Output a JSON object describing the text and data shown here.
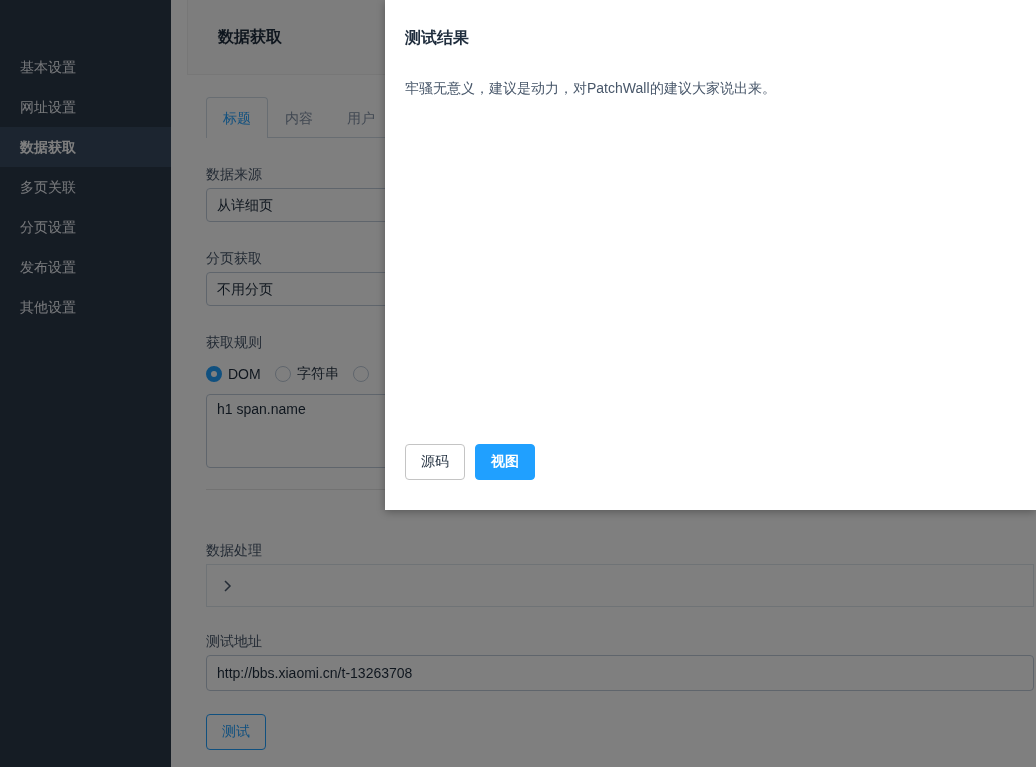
{
  "sidebar": {
    "items": [
      {
        "label": "基本设置",
        "selected": false
      },
      {
        "label": "网址设置",
        "selected": false
      },
      {
        "label": "数据获取",
        "selected": true
      },
      {
        "label": "多页关联",
        "selected": false
      },
      {
        "label": "分页设置",
        "selected": false
      },
      {
        "label": "发布设置",
        "selected": false
      },
      {
        "label": "其他设置",
        "selected": false
      }
    ]
  },
  "header": {
    "title": "数据获取"
  },
  "tabs": [
    {
      "label": "标题",
      "selected": true
    },
    {
      "label": "内容",
      "selected": false
    },
    {
      "label": "用户",
      "selected": false
    }
  ],
  "form": {
    "source": {
      "label": "数据来源",
      "value": "从详细页"
    },
    "paging": {
      "label": "分页获取",
      "value": "不用分页"
    },
    "rule": {
      "label": "获取规则",
      "options": [
        {
          "label": "DOM",
          "selected": true
        },
        {
          "label": "字符串",
          "selected": false
        },
        {
          "selected": false
        }
      ],
      "value": "h1 span.name"
    },
    "processing": {
      "label": "数据处理",
      "expanded": false
    },
    "test_url": {
      "label": "测试地址",
      "value": "http://bbs.xiaomi.cn/t-13263708"
    },
    "test_button": "测试"
  },
  "modal": {
    "title": "测试结果",
    "body": "牢骚无意义，建议是动力，对PatchWall的建议大家说出来。",
    "buttons": [
      {
        "label": "源码",
        "kind": "default"
      },
      {
        "label": "视图",
        "kind": "primary"
      }
    ]
  }
}
